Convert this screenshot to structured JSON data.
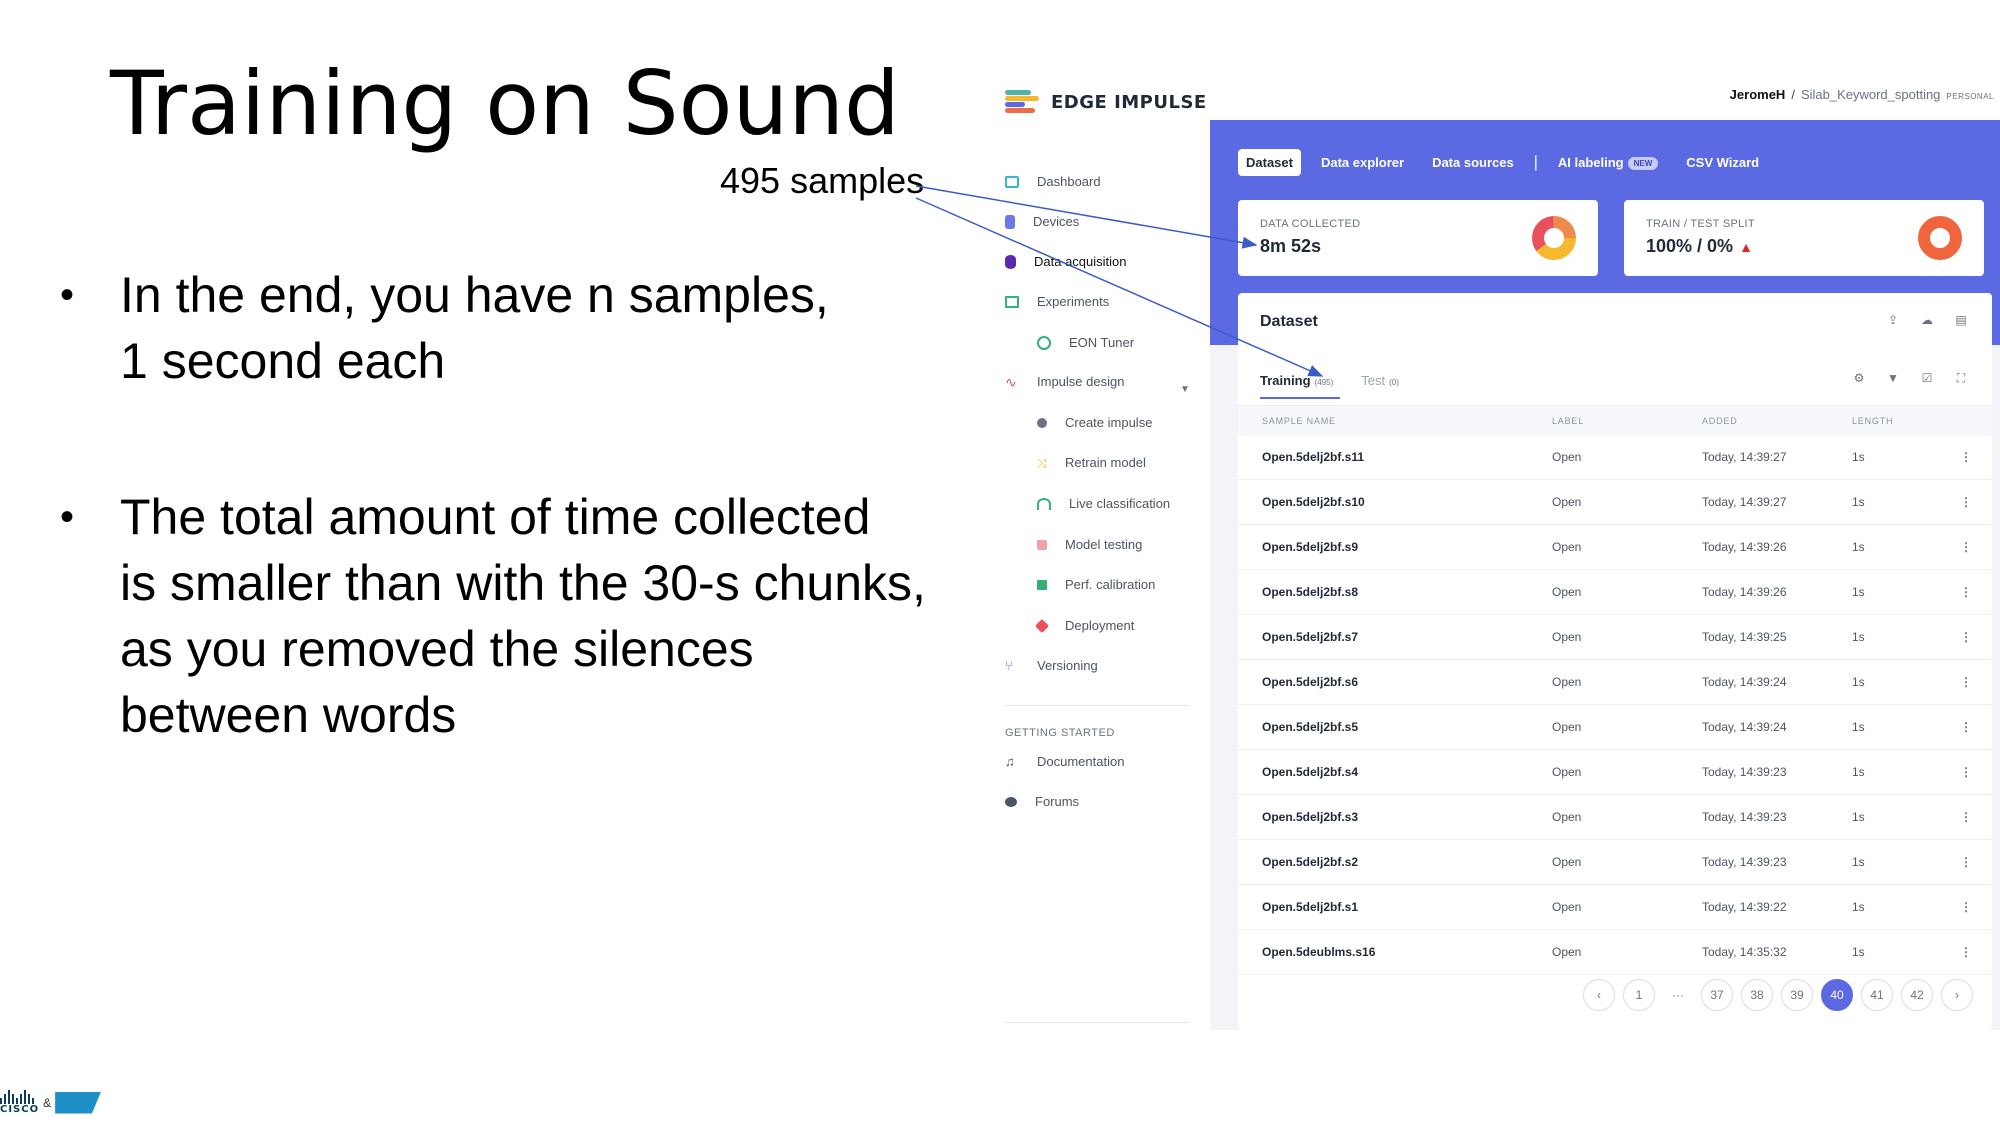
{
  "slide": {
    "title": "Training on Sound",
    "bullets": [
      {
        "lines": [
          "In the end, you have n samples,",
          "1 second each"
        ]
      },
      {
        "lines": [
          "The total amount of time collected",
          "is smaller than with the 30-s chunks,",
          "as you removed the silences",
          "between words"
        ]
      }
    ],
    "annotation": "495 samples"
  },
  "sidebar": {
    "brand": "EDGE IMPULSE",
    "items": [
      {
        "label": "Dashboard"
      },
      {
        "label": "Devices"
      },
      {
        "label": "Data acquisition"
      },
      {
        "label": "Experiments"
      },
      {
        "label": "EON Tuner"
      },
      {
        "label": "Impulse design"
      },
      {
        "label": "Create impulse"
      },
      {
        "label": "Retrain model"
      },
      {
        "label": "Live classification"
      },
      {
        "label": "Model testing"
      },
      {
        "label": "Perf. calibration"
      },
      {
        "label": "Deployment"
      },
      {
        "label": "Versioning"
      }
    ],
    "section_label": "GETTING STARTED",
    "help": [
      {
        "label": "Documentation"
      },
      {
        "label": "Forums"
      }
    ]
  },
  "header": {
    "user": "JeromeH",
    "separator": "/",
    "project": "Silab_Keyword_spotting",
    "badge": "PERSONAL"
  },
  "tabs": {
    "dataset": "Dataset",
    "explorer": "Data explorer",
    "sources": "Data sources",
    "sep": "|",
    "ai": "AI labeling",
    "ai_badge": "NEW",
    "csv": "CSV Wizard"
  },
  "cards": {
    "collected": {
      "label": "DATA COLLECTED",
      "value": "8m 52s"
    },
    "split": {
      "label": "TRAIN / TEST SPLIT",
      "value": "100% / 0%",
      "warning": "▲"
    }
  },
  "dataset": {
    "title": "Dataset",
    "training_tab": "Training",
    "training_count": "(495)",
    "test_tab": "Test",
    "test_count": "(0)",
    "columns": {
      "name": "SAMPLE NAME",
      "label": "LABEL",
      "added": "ADDED",
      "length": "LENGTH"
    },
    "rows": [
      {
        "name": "Open.5delj2bf.s11",
        "label": "Open",
        "added": "Today, 14:39:27",
        "length": "1s"
      },
      {
        "name": "Open.5delj2bf.s10",
        "label": "Open",
        "added": "Today, 14:39:27",
        "length": "1s"
      },
      {
        "name": "Open.5delj2bf.s9",
        "label": "Open",
        "added": "Today, 14:39:26",
        "length": "1s"
      },
      {
        "name": "Open.5delj2bf.s8",
        "label": "Open",
        "added": "Today, 14:39:26",
        "length": "1s"
      },
      {
        "name": "Open.5delj2bf.s7",
        "label": "Open",
        "added": "Today, 14:39:25",
        "length": "1s"
      },
      {
        "name": "Open.5delj2bf.s6",
        "label": "Open",
        "added": "Today, 14:39:24",
        "length": "1s"
      },
      {
        "name": "Open.5delj2bf.s5",
        "label": "Open",
        "added": "Today, 14:39:24",
        "length": "1s"
      },
      {
        "name": "Open.5delj2bf.s4",
        "label": "Open",
        "added": "Today, 14:39:23",
        "length": "1s"
      },
      {
        "name": "Open.5delj2bf.s3",
        "label": "Open",
        "added": "Today, 14:39:23",
        "length": "1s"
      },
      {
        "name": "Open.5delj2bf.s2",
        "label": "Open",
        "added": "Today, 14:39:23",
        "length": "1s"
      },
      {
        "name": "Open.5delj2bf.s1",
        "label": "Open",
        "added": "Today, 14:39:22",
        "length": "1s"
      },
      {
        "name": "Open.5deublms.s16",
        "label": "Open",
        "added": "Today, 14:35:32",
        "length": "1s"
      }
    ],
    "row_menu": "⋮"
  },
  "pagination": {
    "prev": "‹",
    "pages": [
      "1",
      "···",
      "37",
      "38",
      "39",
      "40",
      "41",
      "42"
    ],
    "current": "40",
    "next": "›"
  },
  "footer": {
    "cisco": "CISCO",
    "amp": "&"
  },
  "colors": {
    "accent": "#5b6ae2",
    "arrow": "#3b5bc7"
  },
  "icons": [
    "dashboard-icon",
    "devices-icon",
    "database-icon",
    "experiments-icon",
    "upload-icon",
    "cloud-icon",
    "filter-icon"
  ]
}
